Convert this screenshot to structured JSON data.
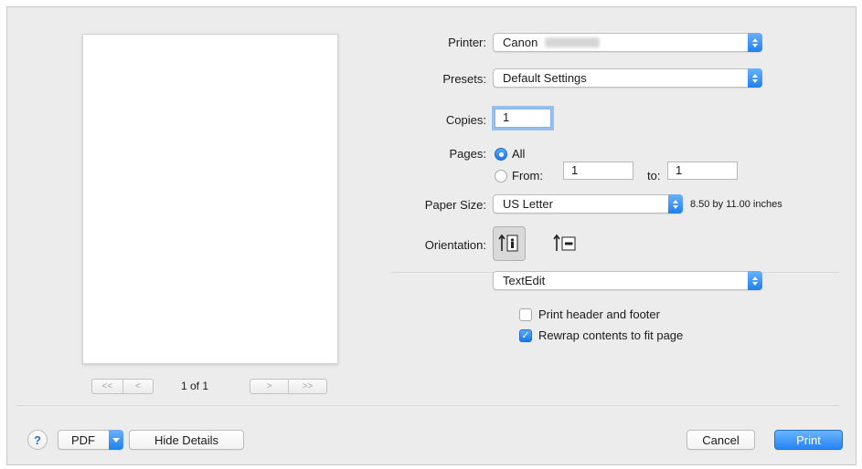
{
  "preview": {
    "page_indicator": "1 of 1",
    "first_label": "<<",
    "prev_label": "<",
    "next_label": ">",
    "last_label": ">>"
  },
  "printer": {
    "label": "Printer:",
    "value": "Canon"
  },
  "presets": {
    "label": "Presets:",
    "value": "Default Settings"
  },
  "copies": {
    "label": "Copies:",
    "value": "1"
  },
  "pages": {
    "label": "Pages:",
    "all_label": "All",
    "from_label": "From:",
    "from_value": "1",
    "to_label": "to:",
    "to_value": "1",
    "selected": "All"
  },
  "paper_size": {
    "label": "Paper Size:",
    "value": "US Letter",
    "dimensions": "8.50 by 11.00 inches"
  },
  "orientation": {
    "label": "Orientation:",
    "options": [
      "portrait",
      "landscape"
    ],
    "selected": "portrait"
  },
  "section_popup": {
    "value": "TextEdit"
  },
  "options": {
    "header_footer": {
      "label": "Print header and footer",
      "checked": false
    },
    "rewrap": {
      "label": "Rewrap contents to fit page",
      "checked": true
    }
  },
  "footer": {
    "help_label": "?",
    "pdf_label": "PDF",
    "hide_details_label": "Hide Details",
    "cancel_label": "Cancel",
    "print_label": "Print"
  },
  "colors": {
    "accent": "#2684f5",
    "background": "#ececec"
  }
}
